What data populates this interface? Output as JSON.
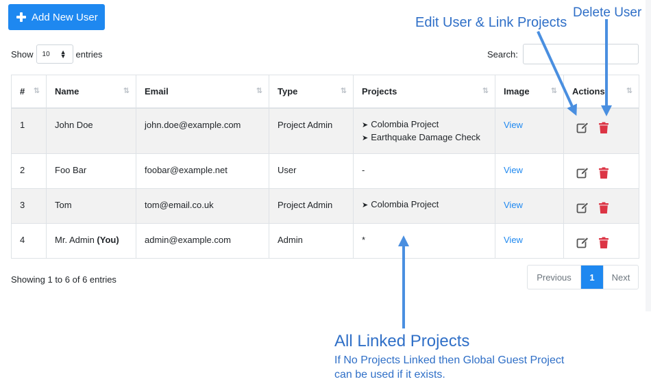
{
  "toolbar": {
    "add_user_label": "Add New User"
  },
  "length_control": {
    "prefix": "Show",
    "value": "10",
    "suffix": "entries"
  },
  "search": {
    "label": "Search:",
    "value": ""
  },
  "table": {
    "columns": [
      "#",
      "Name",
      "Email",
      "Type",
      "Projects",
      "Image",
      "Actions"
    ],
    "rows": [
      {
        "num": "1",
        "name": "John Doe",
        "name_suffix": "",
        "email": "john.doe@example.com",
        "type": "Project Admin",
        "projects": [
          "Colombia Project",
          "Earthquake Damage Check"
        ],
        "projects_text": "",
        "image": "View"
      },
      {
        "num": "2",
        "name": "Foo Bar",
        "name_suffix": "",
        "email": "foobar@example.net",
        "type": "User",
        "projects": [],
        "projects_text": "-",
        "image": "View"
      },
      {
        "num": "3",
        "name": "Tom",
        "name_suffix": "",
        "email": "tom@email.co.uk",
        "type": "Project Admin",
        "projects": [
          "Colombia Project"
        ],
        "projects_text": "",
        "image": "View"
      },
      {
        "num": "4",
        "name": "Mr. Admin",
        "name_suffix": "(You)",
        "email": "admin@example.com",
        "type": "Admin",
        "projects": [],
        "projects_text": "*",
        "image": "View"
      }
    ]
  },
  "footer": {
    "info": "Showing 1 to 6 of 6 entries"
  },
  "pagination": {
    "previous": "Previous",
    "current": "1",
    "next": "Next"
  },
  "annotations": {
    "edit": "Edit User & Link Projects",
    "delete": "Delete User",
    "linked_title": "All Linked Projects",
    "linked_line1": "If No Projects Linked then Global Guest Project",
    "linked_line2": "can be used if it exists."
  },
  "colors": {
    "primary": "#1e88f0",
    "danger": "#dc3545",
    "annotation": "#2f6fc7",
    "arrow": "#4a8fe0"
  },
  "icons": {
    "add": "plus-icon",
    "edit": "edit-icon",
    "delete": "trash-icon",
    "sort": "sort-icon",
    "project": "arrowhead-icon"
  }
}
